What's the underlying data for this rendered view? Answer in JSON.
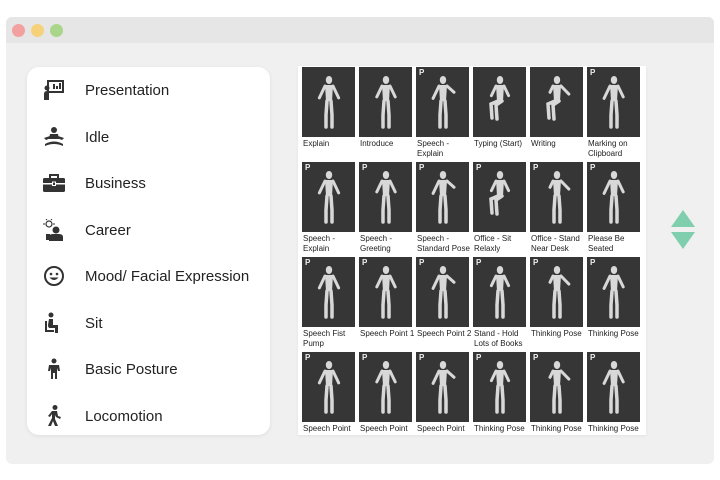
{
  "window": {
    "controls": [
      {
        "name": "close-button",
        "color": "#f2a0a0"
      },
      {
        "name": "minimize-button",
        "color": "#f5d27a"
      },
      {
        "name": "maximize-button",
        "color": "#a9d68a"
      }
    ]
  },
  "menu": {
    "items": [
      {
        "label": "Presentation",
        "icon": "presentation-icon"
      },
      {
        "label": "Idle",
        "icon": "meditation-icon"
      },
      {
        "label": "Business",
        "icon": "briefcase-icon"
      },
      {
        "label": "Career",
        "icon": "career-idea-icon"
      },
      {
        "label": "Mood/ Facial Expression",
        "icon": "smiley-face-icon"
      },
      {
        "label": "Sit",
        "icon": "sitting-person-icon"
      },
      {
        "label": "Basic Posture",
        "icon": "standing-person-icon"
      },
      {
        "label": "Locomotion",
        "icon": "walking-person-icon"
      }
    ]
  },
  "grid": {
    "badge_text": "P",
    "items": [
      {
        "caption": "Explain",
        "badge": false
      },
      {
        "caption": "Introduce",
        "badge": false
      },
      {
        "caption": "Speech - Explain",
        "badge": true
      },
      {
        "caption": "Typing (Start)",
        "badge": false
      },
      {
        "caption": "Writing",
        "badge": false
      },
      {
        "caption": "Marking on Clipboard",
        "badge": true
      },
      {
        "caption": "Speech - Explain",
        "badge": true
      },
      {
        "caption": "Speech - Greeting",
        "badge": true
      },
      {
        "caption": "Speech - Standard Pose",
        "badge": true
      },
      {
        "caption": "Office - Sit Relaxly",
        "badge": true
      },
      {
        "caption": "Office - Stand Near Desk",
        "badge": true
      },
      {
        "caption": "Please Be Seated",
        "badge": true
      },
      {
        "caption": "Speech Fist Pump",
        "badge": true
      },
      {
        "caption": "Speech Point 1",
        "badge": true
      },
      {
        "caption": "Speech Point 2",
        "badge": true
      },
      {
        "caption": "Stand - Hold Lots of Books",
        "badge": true
      },
      {
        "caption": "Thinking Pose",
        "badge": true
      },
      {
        "caption": "Thinking Pose",
        "badge": true
      },
      {
        "caption": "Speech Point",
        "badge": true
      },
      {
        "caption": "Speech Point",
        "badge": true
      },
      {
        "caption": "Speech Point",
        "badge": true
      },
      {
        "caption": "Thinking Pose",
        "badge": true
      },
      {
        "caption": "Thinking Pose",
        "badge": true
      },
      {
        "caption": "Thinking Pose",
        "badge": true
      }
    ]
  },
  "scroll": {
    "up_icon": "scroll-up-arrow-icon",
    "down_icon": "scroll-down-arrow-icon",
    "color": "#7fcfae"
  },
  "colors": {
    "thumb_bg": "#373636",
    "figure": "#d8d8d8",
    "icon": "#333333"
  }
}
